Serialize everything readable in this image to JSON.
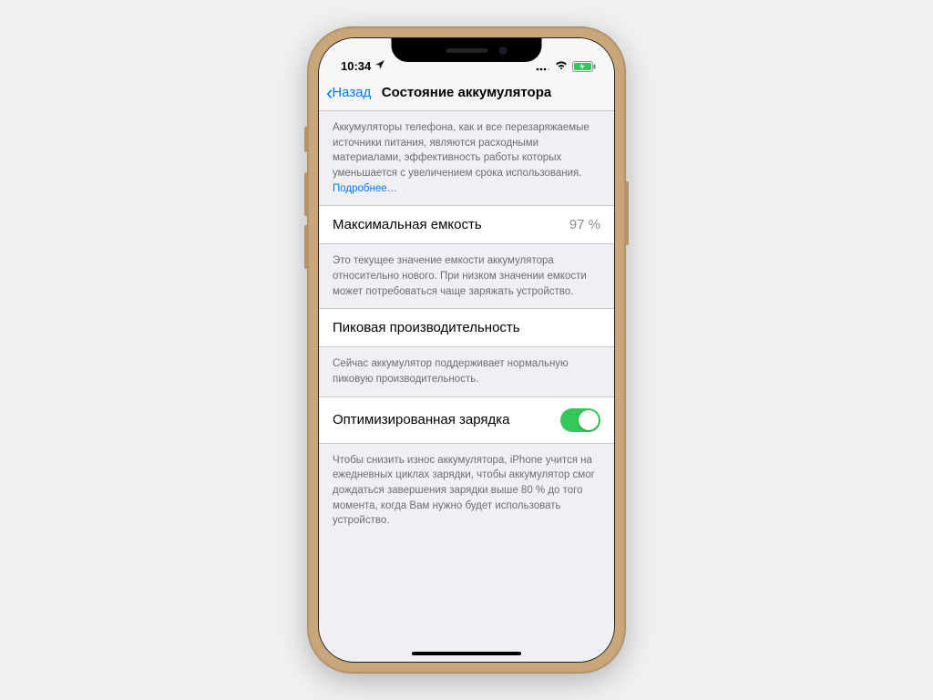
{
  "status": {
    "time": "10:34",
    "location_icon": "location-arrow"
  },
  "nav": {
    "back_label": "Назад",
    "title": "Состояние аккумулятора"
  },
  "sections": {
    "intro": {
      "text": "Аккумуляторы телефона, как и все перезаряжаемые источники питания, являются расходными материалами, эффективность работы которых уменьшается с увеличением срока использования. ",
      "link": "Подробнее…"
    },
    "capacity": {
      "label": "Максимальная емкость",
      "value": "97 %",
      "desc": "Это текущее значение емкости аккумулятора относительно нового. При низком значении емкости может потребоваться чаще заряжать устройство."
    },
    "peak": {
      "label": "Пиковая производительность",
      "desc": "Сейчас аккумулятор поддерживает нормальную пиковую производительность."
    },
    "optimized": {
      "label": "Оптимизированная зарядка",
      "toggle_on": true,
      "desc": "Чтобы снизить износ аккумулятора, iPhone учится на ежедневных циклах зарядки, чтобы аккумулятор смог дождаться завершения зарядки выше 80 % до того момента, когда Вам нужно будет использовать устройство."
    }
  }
}
